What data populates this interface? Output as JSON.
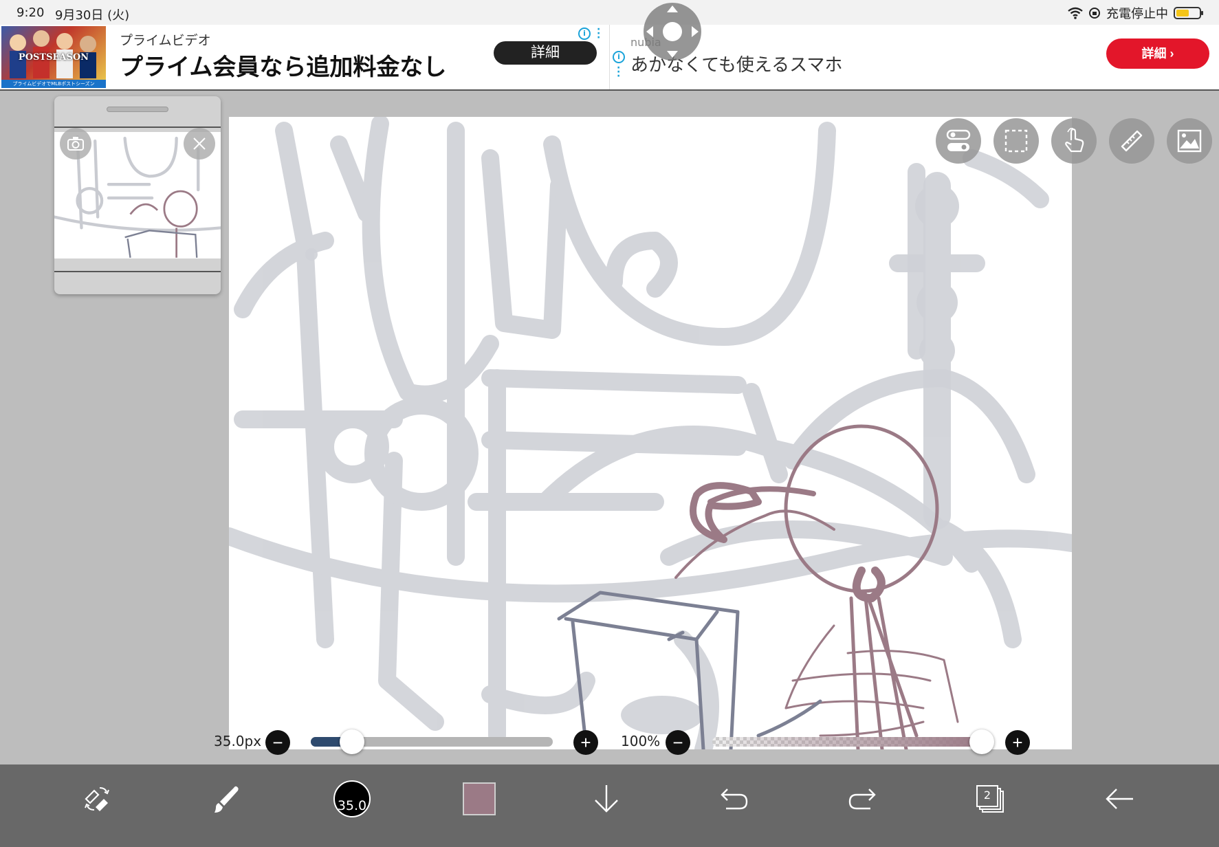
{
  "status_bar": {
    "time": "9:20",
    "date": "9月30日 (火)",
    "charging_text": "充電停止中",
    "battery_percent": 55
  },
  "ads": {
    "left": {
      "thumbnail_text": "POSTSEASON",
      "thumbnail_caption": "プライムビデオでMLBポストシーズン",
      "sponsor": "プライムビデオ",
      "headline": "プライム会員なら追加料金なし",
      "button": "詳細"
    },
    "right": {
      "brand": "nubia",
      "headline": "あかなくても使えるスマホ",
      "button": "詳細 ›"
    },
    "info_glyph": "i",
    "menu_glyph": "⋮"
  },
  "layer_preview": {
    "camera_icon": "camera-icon",
    "close_icon": "close-icon"
  },
  "canvas_tools": [
    {
      "name": "toggle-icon"
    },
    {
      "name": "selection-icon"
    },
    {
      "name": "touch-gesture-icon"
    },
    {
      "name": "ruler-icon"
    },
    {
      "name": "image-icon"
    }
  ],
  "brush_size": {
    "label": "35.0px",
    "value": 35.0,
    "fraction": 0.17,
    "minus": "−",
    "plus": "+"
  },
  "opacity": {
    "label": "100%",
    "value": 100,
    "fraction": 1.0,
    "minus": "−",
    "plus": "+"
  },
  "toolbar": {
    "brush_size_label": "35.0",
    "color": "#9b7a86",
    "layer_count": "2"
  },
  "colors": {
    "stroke_color": "#9b7a86",
    "sketch_gray": "#c9cbd1",
    "toolbar_bg": "#686868",
    "ad_button_red": "#e3162a"
  }
}
